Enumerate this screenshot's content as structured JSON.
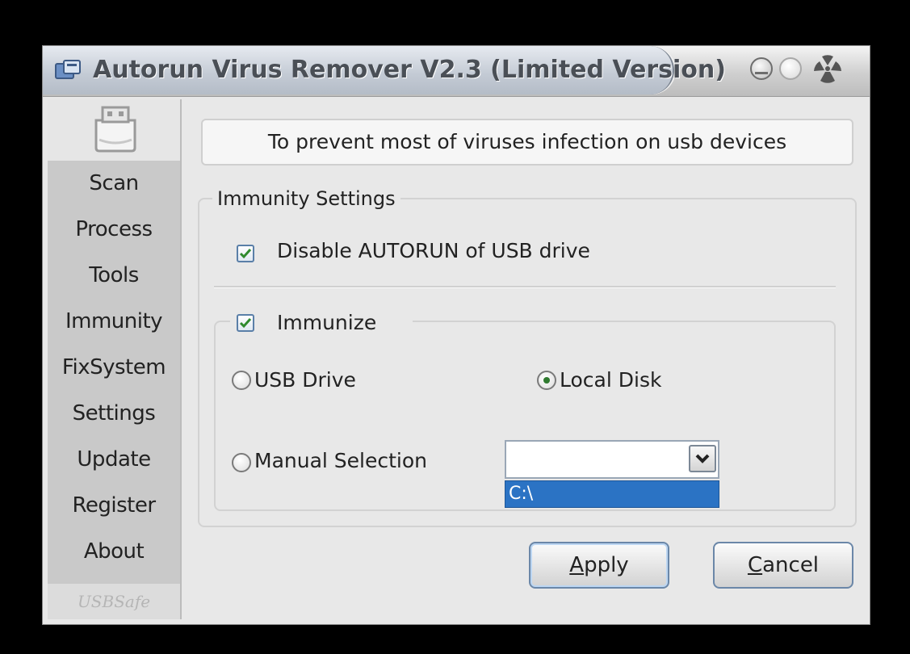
{
  "window": {
    "title": "Autorun Virus Remover V2.3 (Limited Version)"
  },
  "sidebar": {
    "items": [
      {
        "label": "Scan"
      },
      {
        "label": "Process"
      },
      {
        "label": "Tools"
      },
      {
        "label": "Immunity"
      },
      {
        "label": "FixSystem"
      },
      {
        "label": "Settings"
      },
      {
        "label": "Update"
      },
      {
        "label": "Register"
      },
      {
        "label": "About"
      }
    ],
    "footer_text": "USBSafe"
  },
  "main": {
    "banner_text": "To prevent most of viruses infection on usb devices",
    "group_title": "Immunity Settings",
    "disable_autorun": {
      "label": "Disable AUTORUN of USB drive",
      "checked": true
    },
    "immunize": {
      "label": "Immunize",
      "checked": true
    },
    "radio_usb_drive": {
      "label": "USB Drive",
      "checked": false
    },
    "radio_local_disk": {
      "label": "Local Disk",
      "checked": true
    },
    "radio_manual": {
      "label": "Manual Selection",
      "checked": false
    },
    "drive_select": {
      "value": "",
      "options": [
        "C:\\"
      ],
      "highlighted_option": "C:\\"
    }
  },
  "buttons": {
    "apply_mnemonic": "A",
    "apply_rest": "pply",
    "cancel_mnemonic": "C",
    "cancel_rest": "ancel"
  },
  "colors": {
    "check_green": "#2f8a2f",
    "selection_blue": "#2b73c4",
    "sidebar_bg": "#c9c9c9"
  }
}
